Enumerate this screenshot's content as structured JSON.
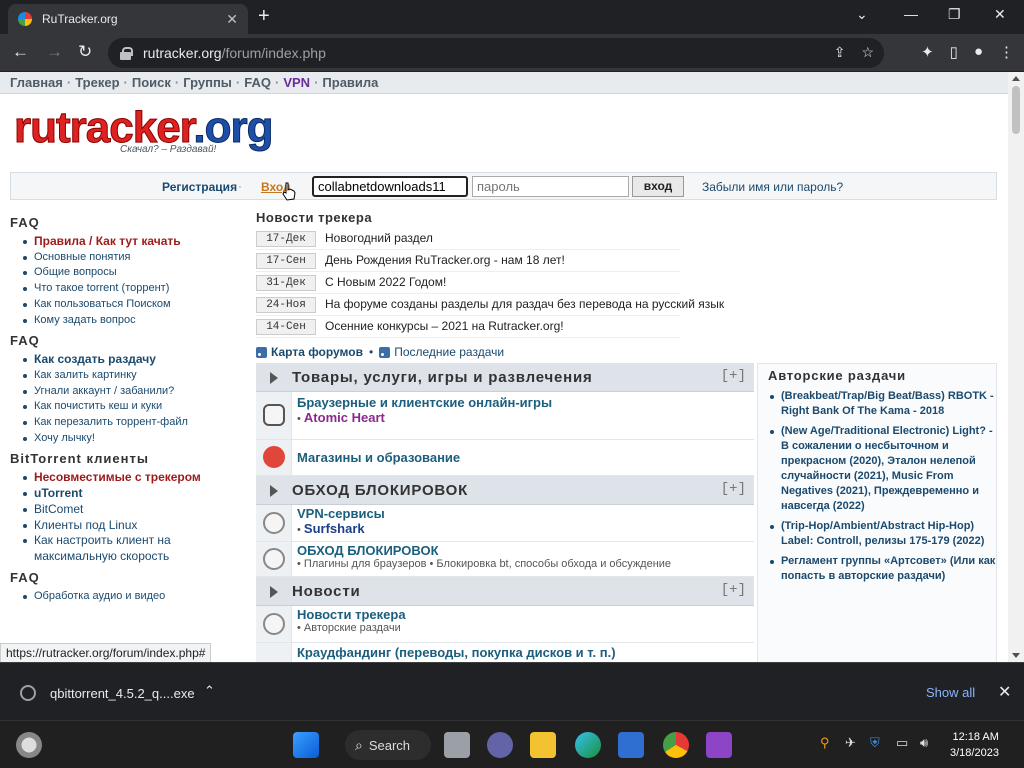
{
  "browser": {
    "tab_title": "RuTracker.org",
    "tab_close": "✕",
    "new_tab": "+",
    "window_controls": [
      "⌄",
      "—",
      "❐",
      "✕"
    ],
    "back": "←",
    "forward": "→",
    "reload": "↻",
    "url_host": "rutracker.org",
    "url_path": "/forum/index.php",
    "url_icons": [
      "⇪",
      "☆"
    ],
    "toolbar_icons": [
      "✦",
      "▯",
      "●",
      "⋮"
    ]
  },
  "site": {
    "nav": [
      "Главная",
      "Трекер",
      "Поиск",
      "Группы",
      "FAQ",
      "VPN",
      "Правила"
    ],
    "nav_sep": "·",
    "logo_text_red": "rutracker",
    "logo_text_blue": ".org",
    "logo_tagline": "Скачал? – Раздавай!"
  },
  "login": {
    "register": "Регистрация",
    "dot": "·",
    "login_link": "Вход",
    "username_value": "collabnetdownloads11",
    "password_placeholder": "пароль",
    "submit": "вход",
    "forgot": "Забыли имя или пароль?"
  },
  "sidebar": {
    "faq1_title": "FAQ",
    "faq1_first_a": "Правила",
    "faq1_first_sep": " / ",
    "faq1_first_b": "Как тут качать",
    "faq1_items": [
      "Основные понятия",
      "Общие вопросы",
      "Что такое torrent (торрент)",
      "Как пользоваться Поиском",
      "Кому задать вопрос"
    ],
    "faq2_title": "FAQ",
    "faq2_items": [
      "Как создать раздачу",
      "Как залить картинку",
      "Угнали аккаунт / забанили?",
      "Как почистить кеш и куки",
      "Как перезалить торрент-файл",
      "Хочу лычку!"
    ],
    "bt_title": "BitTorrent клиенты",
    "bt_items": [
      "Несовместимые с трекером",
      "uTorrent",
      "BitComet",
      "Клиенты под Linux",
      "Как настроить клиент на максимальную скорость"
    ],
    "faq3_title": "FAQ",
    "faq3_items": [
      "Обработка аудио и видео"
    ]
  },
  "news": {
    "title": "Новости трекера",
    "items": [
      {
        "date": "17-Дек",
        "text": "Новогодний раздел"
      },
      {
        "date": "17-Сен",
        "text": "День Рождения RuTracker.org - нам 18 лет!"
      },
      {
        "date": "31-Дек",
        "text": "С Новым 2022 Годом!"
      },
      {
        "date": "24-Ноя",
        "text": "На форуме созданы разделы для раздач без перевода на русский язык"
      },
      {
        "date": "14-Сен",
        "text": "Осенние конкурсы – 2021 на Rutracker.org!"
      }
    ],
    "map_link": "Карта форумов",
    "recent_link": "Последние раздачи",
    "feed_sep": "•"
  },
  "forum": {
    "expand": "[+]",
    "cat1": "Товары, услуги, игры и развлечения",
    "f1_title": "Браузерные и клиентские онлайн-игры",
    "f1_sub": "Atomic Heart",
    "f2_title": "Магазины и образование",
    "cat2": "ОБХОД БЛОКИРОВОК",
    "f3_title": "VPN-сервисы",
    "f3_sub": "Surfshark",
    "f4_title": "ОБХОД БЛОКИРОВОК",
    "f4_sub1": "Плагины для браузеров",
    "f4_sub2": "Блокировка bt, способы обхода и обсуждение",
    "cat3": "Новости",
    "f5_title": "Новости трекера",
    "f5_sub": "Авторские раздачи",
    "f6_title": "Краудфандинг (переводы, покупка дисков и т. п.)",
    "bullet": "•"
  },
  "right": {
    "title": "Авторские раздачи",
    "items": [
      "(Breakbeat/Trap/Big Beat/Bass) RBOTK - Right Bank Of The Kama - 2018",
      "(New Age/Traditional Electronic) Light? - В сожалении о несбыточном и прекрасном (2020), Эталон нелепой случайности (2021), Music From Negatives (2021), Преждевременно и навсегда (2022)",
      "(Trip-Hop/Ambient/Abstract Hip-Hop) Label: Controll, релизы 175-179 (2022)",
      "Регламент группы «Артсовет» (Или как попасть в авторские раздачи)"
    ]
  },
  "status_url": "https://rutracker.org/forum/index.php#",
  "downloads": {
    "file": "qbittorrent_4.5.2_q....exe",
    "chevron": "⌃",
    "show_all": "Show all",
    "close": "✕"
  },
  "taskbar": {
    "search": "Search",
    "time": "12:18 AM",
    "date": "3/18/2023"
  }
}
